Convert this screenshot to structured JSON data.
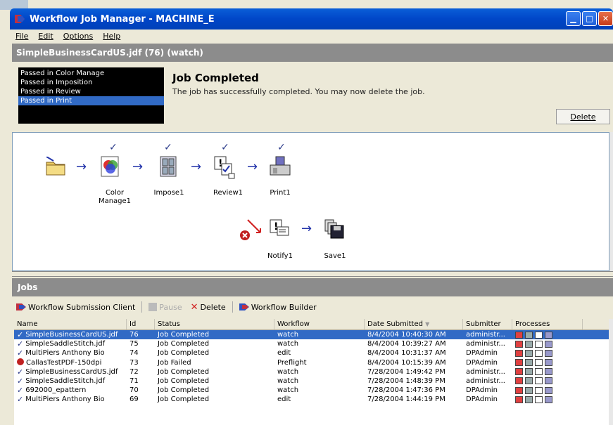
{
  "window": {
    "title": "Workflow Job Manager - MACHINE_E"
  },
  "menu": [
    "File",
    "Edit",
    "Options",
    "Help"
  ],
  "job_header": "SimpleBusinessCardUS.jdf (76) (watch)",
  "steps": [
    "Passed in Color Manage",
    "Passed in Imposition",
    "Passed in Review",
    "Passed in Print"
  ],
  "selected_step": 3,
  "status": {
    "title": "Job Completed",
    "message": "The job has successfully completed.  You may now delete the job.",
    "delete_label": "Delete"
  },
  "flow": {
    "nodes_top": [
      "Color\nManage1",
      "Impose1",
      "Review1",
      "Print1"
    ],
    "nodes_bottom": [
      "Notify1",
      "Save1"
    ]
  },
  "jobs": {
    "header": "Jobs",
    "toolbar": {
      "submission": "Workflow Submission Client",
      "pause": "Pause",
      "delete": "Delete",
      "builder": "Workflow Builder"
    },
    "columns": [
      "Name",
      "Id",
      "Status",
      "Workflow",
      "Date Submitted",
      "Submitter",
      "Processes"
    ],
    "rows": [
      {
        "name": "SimpleBusinessCardUS.jdf",
        "id": "76",
        "status": "Job Completed",
        "workflow": "watch",
        "date": "8/4/2004 10:40:30 AM",
        "submitter": "administr...",
        "ok": true
      },
      {
        "name": "SimpleSaddleStitch.jdf",
        "id": "75",
        "status": "Job Completed",
        "workflow": "watch",
        "date": "8/4/2004 10:39:27 AM",
        "submitter": "administr...",
        "ok": true
      },
      {
        "name": "MultiPiers Anthony Bio",
        "id": "74",
        "status": "Job Completed",
        "workflow": "edit",
        "date": "8/4/2004 10:31:37 AM",
        "submitter": "DPAdmin",
        "ok": true
      },
      {
        "name": "CallasTestPDF-150dpi",
        "id": "73",
        "status": "Job Failed",
        "workflow": "Preflight",
        "date": "8/4/2004 10:15:39 AM",
        "submitter": "DPAdmin",
        "ok": false
      },
      {
        "name": "SimpleBusinessCardUS.jdf",
        "id": "72",
        "status": "Job Completed",
        "workflow": "watch",
        "date": "7/28/2004 1:49:42 PM",
        "submitter": "administr...",
        "ok": true
      },
      {
        "name": "SimpleSaddleStitch.jdf",
        "id": "71",
        "status": "Job Completed",
        "workflow": "watch",
        "date": "7/28/2004 1:48:39 PM",
        "submitter": "administr...",
        "ok": true
      },
      {
        "name": "692000_epattern",
        "id": "70",
        "status": "Job Completed",
        "workflow": "watch",
        "date": "7/28/2004 1:47:36 PM",
        "submitter": "DPAdmin",
        "ok": true
      },
      {
        "name": "MultiPiers Anthony Bio",
        "id": "69",
        "status": "Job Completed",
        "workflow": "edit",
        "date": "7/28/2004 1:44:19 PM",
        "submitter": "DPAdmin",
        "ok": true
      }
    ],
    "selected_row": 0
  }
}
